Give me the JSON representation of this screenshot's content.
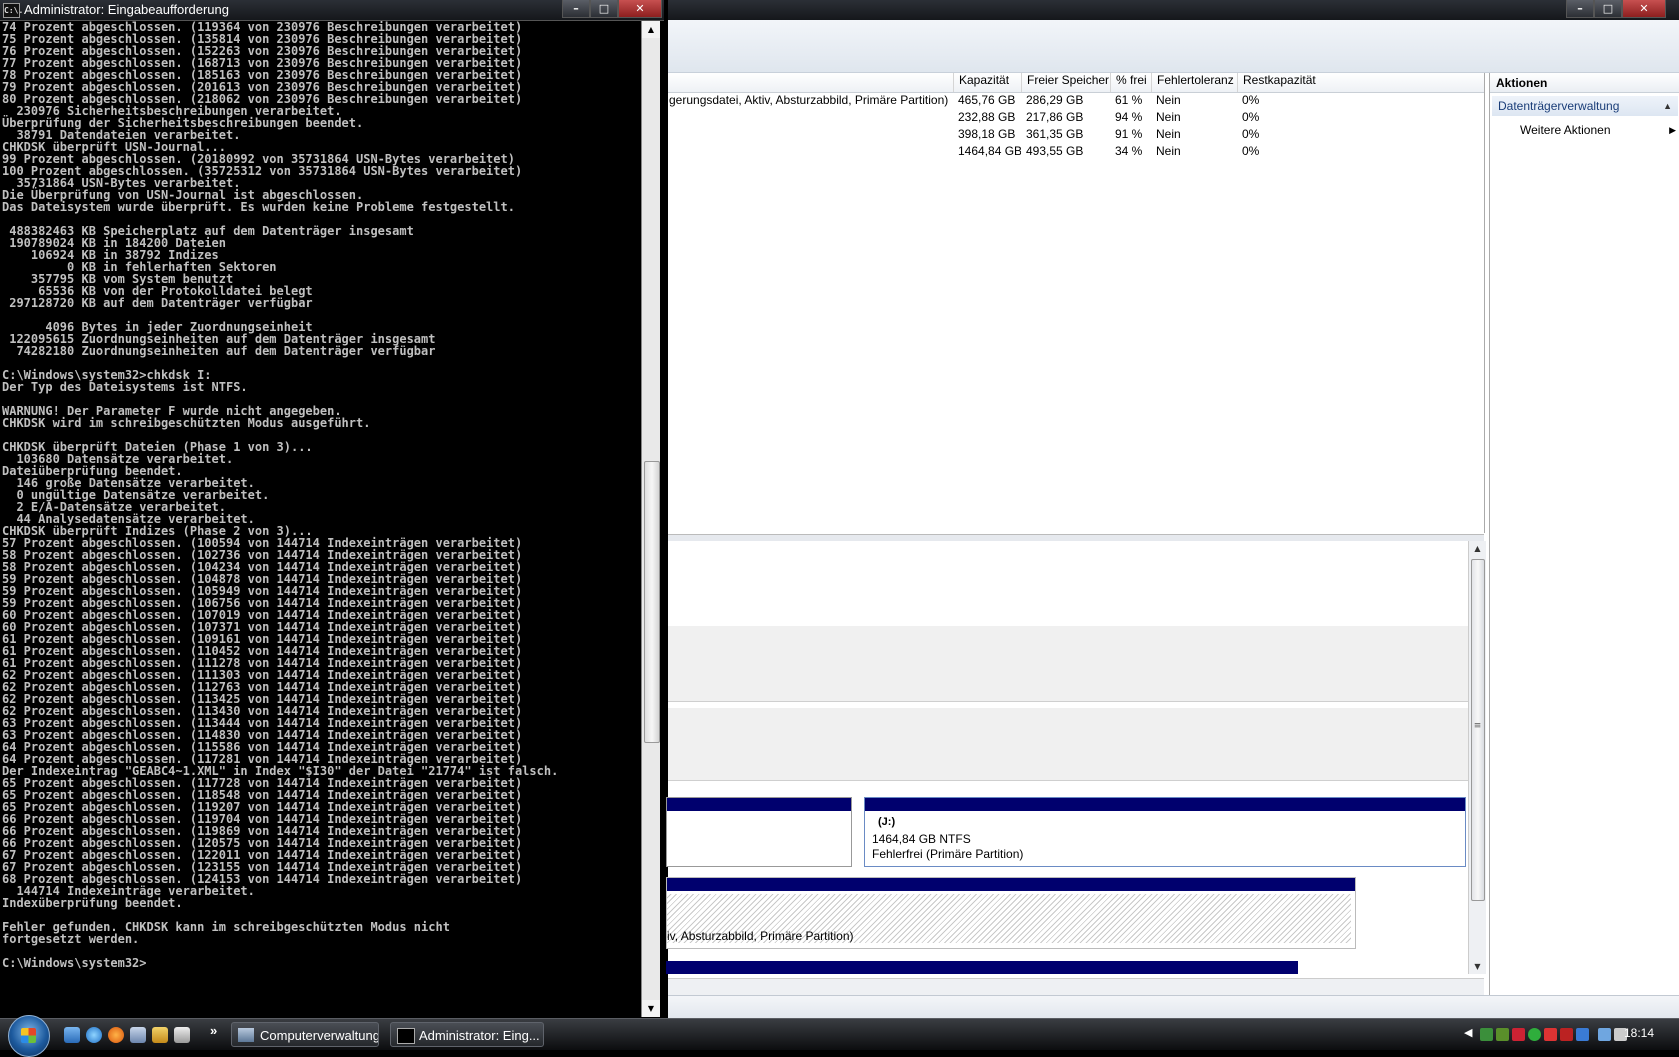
{
  "console": {
    "title": "Administrator: Eingabeaufforderung",
    "icon_text": "C:\\.",
    "lines": [
      "74 Prozent abgeschlossen. (119364 von 230976 Beschreibungen verarbeitet)",
      "75 Prozent abgeschlossen. (135814 von 230976 Beschreibungen verarbeitet)",
      "76 Prozent abgeschlossen. (152263 von 230976 Beschreibungen verarbeitet)",
      "77 Prozent abgeschlossen. (168713 von 230976 Beschreibungen verarbeitet)",
      "78 Prozent abgeschlossen. (185163 von 230976 Beschreibungen verarbeitet)",
      "79 Prozent abgeschlossen. (201613 von 230976 Beschreibungen verarbeitet)",
      "80 Prozent abgeschlossen. (218062 von 230976 Beschreibungen verarbeitet)",
      "  230976 Sicherheitsbeschreibungen verarbeitet.",
      "Überprüfung der Sicherheitsbeschreibungen beendet.",
      "  38791 Datendateien verarbeitet.",
      "CHKDSK überprüft USN-Journal...",
      "99 Prozent abgeschlossen. (20180992 von 35731864 USN-Bytes verarbeitet)",
      "100 Prozent abgeschlossen. (35725312 von 35731864 USN-Bytes verarbeitet)",
      "  35731864 USN-Bytes verarbeitet.",
      "Die Überprüfung von USN-Journal ist abgeschlossen.",
      "Das Dateisystem wurde überprüft. Es wurden keine Probleme festgestellt.",
      "",
      " 488382463 KB Speicherplatz auf dem Datenträger insgesamt",
      " 190789024 KB in 184200 Dateien",
      "    106924 KB in 38792 Indizes",
      "         0 KB in fehlerhaften Sektoren",
      "    357795 KB vom System benutzt",
      "     65536 KB von der Protokolldatei belegt",
      " 297128720 KB auf dem Datenträger verfügbar",
      "",
      "      4096 Bytes in jeder Zuordnungseinheit",
      " 122095615 Zuordnungseinheiten auf dem Datenträger insgesamt",
      "  74282180 Zuordnungseinheiten auf dem Datenträger verfügbar",
      "",
      "C:\\Windows\\system32>chkdsk I:",
      "Der Typ des Dateisystems ist NTFS.",
      "",
      "WARNUNG! Der Parameter F wurde nicht angegeben.",
      "CHKDSK wird im schreibgeschützten Modus ausgeführt.",
      "",
      "CHKDSK überprüft Dateien (Phase 1 von 3)...",
      "  103680 Datensätze verarbeitet.",
      "Dateiüberprüfung beendet.",
      "  146 große Datensätze verarbeitet.",
      "  0 ungültige Datensätze verarbeitet.",
      "  2 E/A-Datensätze verarbeitet.",
      "  44 Analysedatensätze verarbeitet.",
      "CHKDSK überprüft Indizes (Phase 2 von 3)...",
      "57 Prozent abgeschlossen. (100594 von 144714 Indexeinträgen verarbeitet)",
      "58 Prozent abgeschlossen. (102736 von 144714 Indexeinträgen verarbeitet)",
      "58 Prozent abgeschlossen. (104234 von 144714 Indexeinträgen verarbeitet)",
      "59 Prozent abgeschlossen. (104878 von 144714 Indexeinträgen verarbeitet)",
      "59 Prozent abgeschlossen. (105949 von 144714 Indexeinträgen verarbeitet)",
      "59 Prozent abgeschlossen. (106756 von 144714 Indexeinträgen verarbeitet)",
      "60 Prozent abgeschlossen. (107019 von 144714 Indexeinträgen verarbeitet)",
      "60 Prozent abgeschlossen. (107371 von 144714 Indexeinträgen verarbeitet)",
      "61 Prozent abgeschlossen. (109161 von 144714 Indexeinträgen verarbeitet)",
      "61 Prozent abgeschlossen. (110452 von 144714 Indexeinträgen verarbeitet)",
      "61 Prozent abgeschlossen. (111278 von 144714 Indexeinträgen verarbeitet)",
      "62 Prozent abgeschlossen. (111303 von 144714 Indexeinträgen verarbeitet)",
      "62 Prozent abgeschlossen. (112763 von 144714 Indexeinträgen verarbeitet)",
      "62 Prozent abgeschlossen. (113425 von 144714 Indexeinträgen verarbeitet)",
      "62 Prozent abgeschlossen. (113430 von 144714 Indexeinträgen verarbeitet)",
      "63 Prozent abgeschlossen. (113444 von 144714 Indexeinträgen verarbeitet)",
      "63 Prozent abgeschlossen. (114830 von 144714 Indexeinträgen verarbeitet)",
      "64 Prozent abgeschlossen. (115586 von 144714 Indexeinträgen verarbeitet)",
      "64 Prozent abgeschlossen. (117281 von 144714 Indexeinträgen verarbeitet)",
      "Der Indexeintrag \"GEABC4~1.XML\" in Index \"$I30\" der Datei \"21774\" ist falsch.",
      "65 Prozent abgeschlossen. (117728 von 144714 Indexeinträgen verarbeitet)",
      "65 Prozent abgeschlossen. (118548 von 144714 Indexeinträgen verarbeitet)",
      "65 Prozent abgeschlossen. (119207 von 144714 Indexeinträgen verarbeitet)",
      "66 Prozent abgeschlossen. (119704 von 144714 Indexeinträgen verarbeitet)",
      "66 Prozent abgeschlossen. (119869 von 144714 Indexeinträgen verarbeitet)",
      "66 Prozent abgeschlossen. (120575 von 144714 Indexeinträgen verarbeitet)",
      "67 Prozent abgeschlossen. (122011 von 144714 Indexeinträgen verarbeitet)",
      "67 Prozent abgeschlossen. (123155 von 144714 Indexeinträgen verarbeitet)",
      "68 Prozent abgeschlossen. (124153 von 144714 Indexeinträgen verarbeitet)",
      "  144714 Indexeinträge verarbeitet.",
      "Indexüberprüfung beendet.",
      "",
      "Fehler gefunden. CHKDSK kann im schreibgeschützten Modus nicht",
      "fortgesetzt werden.",
      "",
      "C:\\Windows\\system32>"
    ]
  },
  "volumes": {
    "columns": [
      "Kapazität",
      "Freier Speicher",
      "% frei",
      "Fehlertoleranz",
      "Restkapazität"
    ],
    "rows": [
      {
        "status": "gerungsdatei, Aktiv, Absturzabbild, Primäre Partition)",
        "capacity": "465,76 GB",
        "free": "286,29 GB",
        "pct": "61 %",
        "fault": "Nein",
        "overhead": "0%"
      },
      {
        "status": "",
        "capacity": "232,88 GB",
        "free": "217,86 GB",
        "pct": "94 %",
        "fault": "Nein",
        "overhead": "0%"
      },
      {
        "status": "",
        "capacity": "398,18 GB",
        "free": "361,35 GB",
        "pct": "91 %",
        "fault": "Nein",
        "overhead": "0%"
      },
      {
        "status": "",
        "capacity": "1464,84 GB",
        "free": "493,55 GB",
        "pct": "34 %",
        "fault": "Nein",
        "overhead": "0%"
      }
    ]
  },
  "graph": {
    "j_name": "(J:)",
    "j_size": "1464,84 GB NTFS",
    "j_status": "Fehlerfrei (Primäre Partition)",
    "c_status": "iv, Absturzabbild, Primäre Partition)"
  },
  "actions": {
    "title": "Aktionen",
    "group": "Datenträgerverwaltung",
    "more": "Weitere Aktionen"
  },
  "taskbar": {
    "apps": [
      {
        "label": "Computerverwaltung"
      },
      {
        "label": "Administrator: Eing..."
      }
    ],
    "clock": "18:14",
    "chevron": "»"
  },
  "colors": {
    "console_bg": "#000000",
    "console_text": "#c0c0c0",
    "partition_header": "#00006e",
    "taskbar": "#1b1d20"
  }
}
